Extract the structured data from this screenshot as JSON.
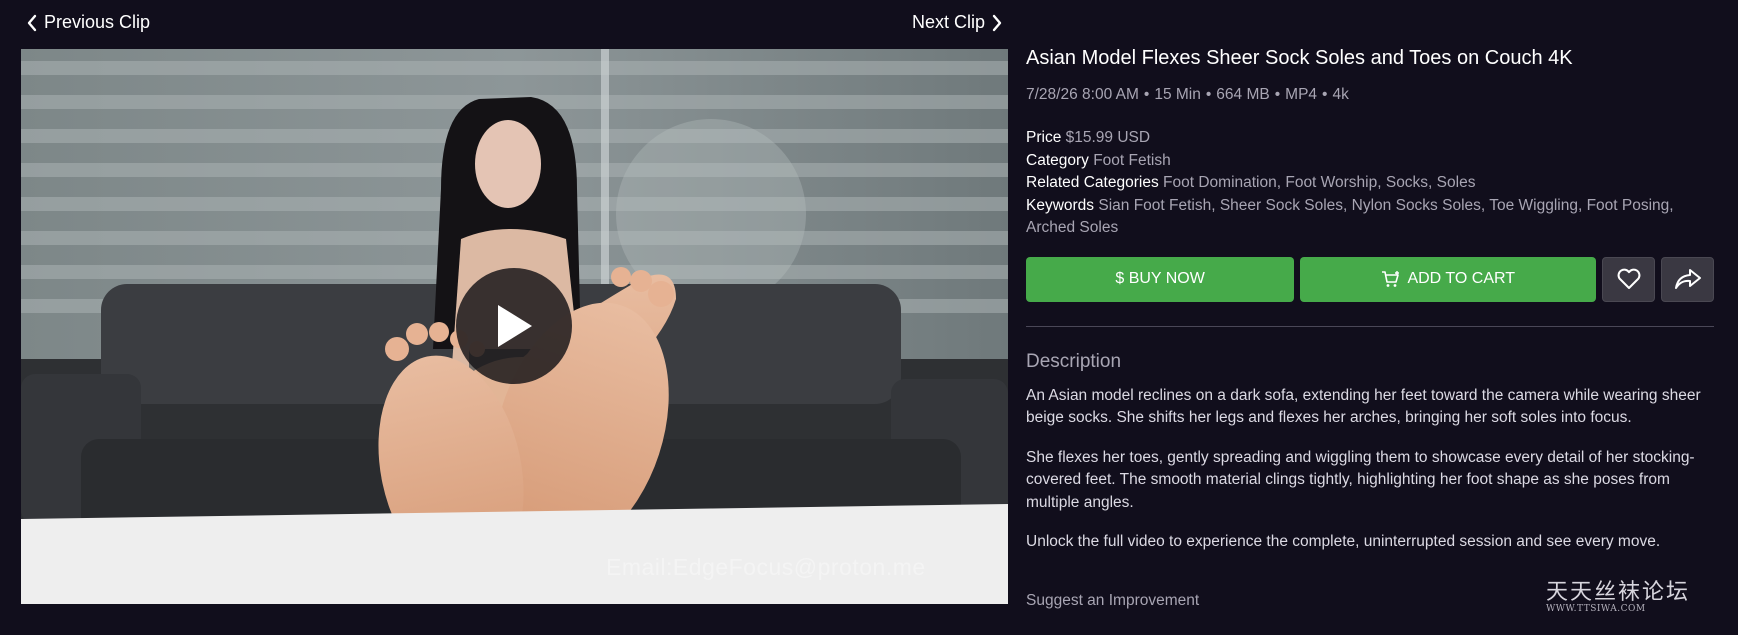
{
  "nav": {
    "previous_label": "Previous Clip",
    "next_label": "Next Clip"
  },
  "video": {
    "watermark": "Email:EdgeFocus@proton.me"
  },
  "clip": {
    "title": "Asian Model Flexes Sheer Sock Soles and Toes on Couch 4K",
    "date": "7/28/26 8:00 AM",
    "duration": "15 Min",
    "size": "664 MB",
    "format": "MP4",
    "resolution": "4k",
    "separator": "•"
  },
  "details": {
    "price_label": "Price",
    "price_value": "$15.99 USD",
    "category_label": "Category",
    "category_value": "Foot Fetish",
    "related_label": "Related Categories",
    "related_value": "Foot Domination, Foot Worship, Socks, Soles",
    "keywords_label": "Keywords",
    "keywords_value": "Sian Foot Fetish, Sheer Sock Soles, Nylon Socks Soles, Toe Wiggling, Foot Posing, Arched Soles"
  },
  "actions": {
    "buy_label": "$ BUY NOW",
    "cart_label": "ADD TO CART",
    "favorite_icon": "heart-icon",
    "share_icon": "share-icon"
  },
  "description": {
    "heading": "Description",
    "paragraphs": [
      "An Asian model reclines on a dark sofa, extending her feet toward the camera while wearing sheer beige socks. She shifts her legs and flexes her arches, bringing her soft soles into focus.",
      "She flexes her toes, gently spreading and wiggling them to showcase every detail of her stocking-covered feet. The smooth material clings tightly, highlighting her foot shape as she poses from multiple angles.",
      "Unlock the full video to experience the complete, uninterrupted session and see every move."
    ]
  },
  "footer": {
    "suggest_label": "Suggest an Improvement",
    "site_watermark_cn": "天天丝袜论坛",
    "site_watermark_url": "WWW.TTSIWA.COM"
  },
  "colors": {
    "background": "#110e1c",
    "accent_green": "#46aa4a",
    "muted_text": "#a8a5b3"
  }
}
